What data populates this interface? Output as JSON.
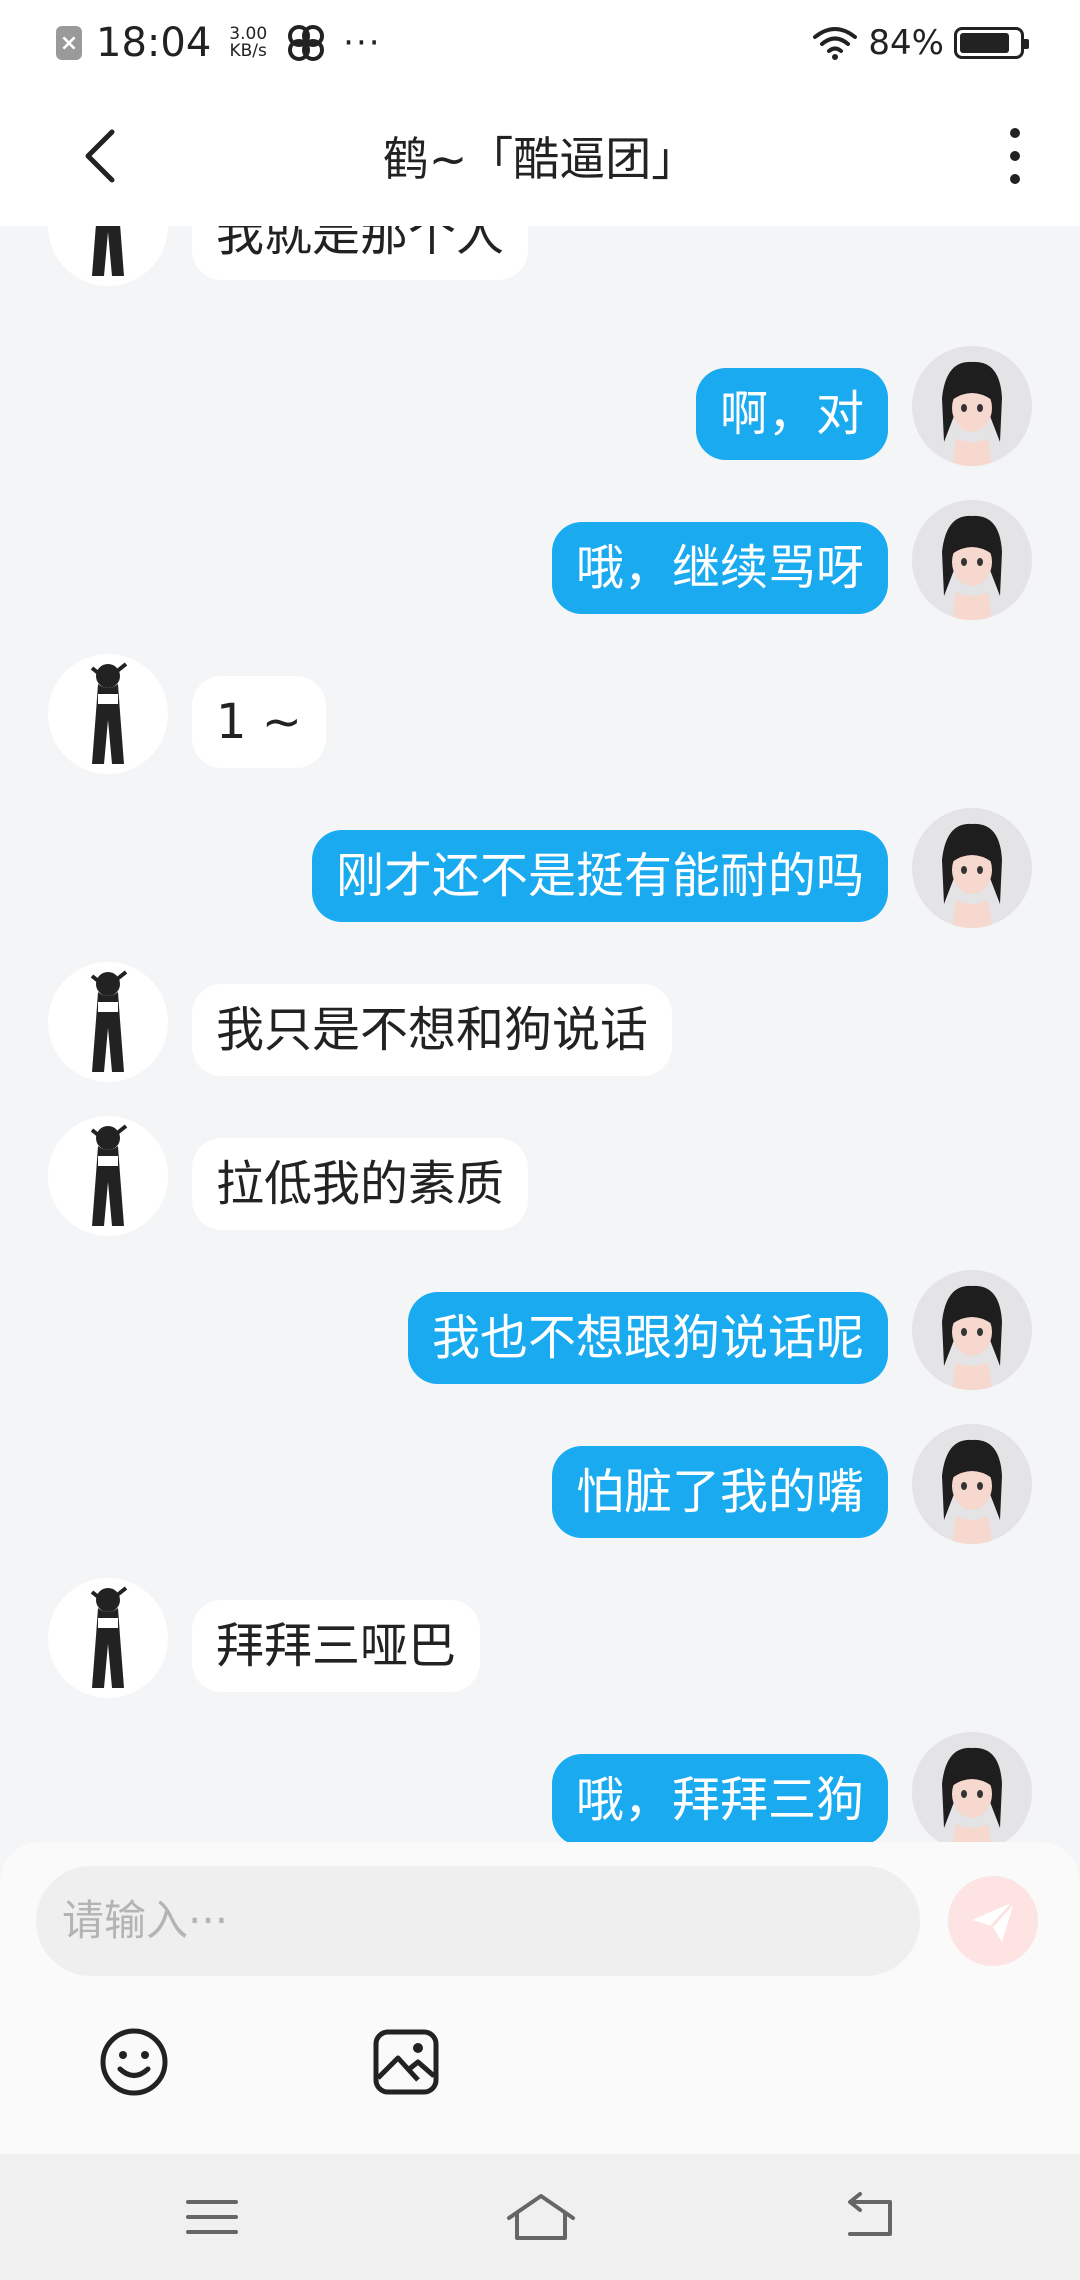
{
  "status_bar": {
    "time": "18:04",
    "net_speed_value": "3.00",
    "net_speed_unit": "KB/s",
    "more_dots": "···",
    "battery_text": "84%",
    "battery_level": 0.84,
    "close_glyph": "×"
  },
  "header": {
    "title": "鹤~「酷逼团」",
    "back_icon": "chevron-left-icon",
    "more_icon": "more-vertical-icon"
  },
  "messages": [
    {
      "side": "left",
      "text": "我就是那个人"
    },
    {
      "side": "right",
      "text": "啊，对"
    },
    {
      "side": "right",
      "text": "哦，继续骂呀"
    },
    {
      "side": "left",
      "text": "1 ~"
    },
    {
      "side": "right",
      "text": "刚才还不是挺有能耐的吗"
    },
    {
      "side": "left",
      "text": "我只是不想和狗说话"
    },
    {
      "side": "left",
      "text": "拉低我的素质"
    },
    {
      "side": "right",
      "text": "我也不想跟狗说话呢"
    },
    {
      "side": "right",
      "text": "怕脏了我的嘴"
    },
    {
      "side": "left",
      "text": "拜拜三哑巴"
    },
    {
      "side": "right",
      "text": "哦，拜拜三狗"
    }
  ],
  "input": {
    "placeholder": "请输入···",
    "send_icon": "send-icon",
    "emoji_icon": "emoji-icon",
    "image_icon": "image-icon"
  },
  "nav": {
    "menu_icon": "menu-icon",
    "home_icon": "home-icon",
    "back_icon": "back-icon"
  },
  "colors": {
    "accent_bubble": "#1aaaf0",
    "background": "#f4f5f7",
    "send_button": "#fde3e1"
  }
}
